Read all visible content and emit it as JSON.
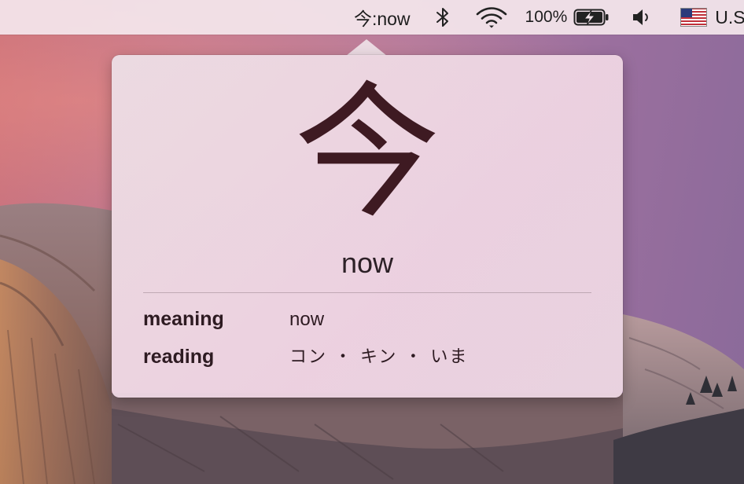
{
  "menubar": {
    "kanji_title": "今:now",
    "battery_percent": "100%",
    "input_source": "U.S."
  },
  "popover": {
    "kanji": "今",
    "headline_meaning": "now",
    "meaning_label": "meaning",
    "meaning_value": "now",
    "reading_label": "reading",
    "reading_value": "コン ・ キン ・ いま"
  },
  "colors": {
    "kanji_text": "#3e1a22",
    "menubar_bg": "#f4e6ec",
    "popover_bg": "#ecdde4"
  },
  "icons": {
    "bluetooth": "bluetooth-icon",
    "wifi": "wifi-icon",
    "battery": "battery-charging-icon",
    "volume": "volume-icon",
    "flag": "us-flag-icon"
  }
}
